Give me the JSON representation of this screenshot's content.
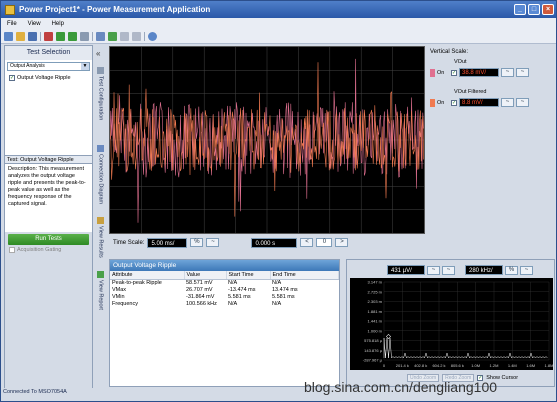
{
  "window": {
    "title": "Power Project1* - Power Measurement Application"
  },
  "menu": [
    "File",
    "View",
    "Help"
  ],
  "left": {
    "header": "Test Selection",
    "dropdown_value": "Output Analysis",
    "tree_item": "Output Voltage Ripple",
    "desc_title": "Test: Output Voltage Ripple",
    "desc_text": "Description: This measurement analyzes the output voltage ripple and presents the peak-to-peak value as well as the frequency response of the captured signal.",
    "run_button": "Run Tests",
    "gating_label": "Acquisition Gating"
  },
  "vtabs": [
    "Test Configuration",
    "Connection Diagram",
    "View Results",
    "View Report"
  ],
  "vertical_scale": {
    "label": "Vertical Scale:",
    "channels": [
      {
        "name": "VOut",
        "on": "On",
        "value": "38.8 mV/",
        "color": "#e07090"
      },
      {
        "name": "VOut Filtered",
        "on": "On",
        "value": "8.8 mV/",
        "color": "#f07a50"
      }
    ]
  },
  "timebar": {
    "label": "Time Scale:",
    "value": "5.00 ms/",
    "offset": "0.000 s",
    "page": "0"
  },
  "results": {
    "header": "Output Voltage Ripple",
    "columns": [
      "Attribute",
      "Value",
      "Start Time",
      "End Time"
    ],
    "rows": [
      [
        "Peak-to-peak Ripple",
        "58.571 mV",
        "N/A",
        "N/A"
      ],
      [
        "VMax",
        "26.707 mV",
        "-13.474 ms",
        "13.474 ms"
      ],
      [
        "VMin",
        "-31.864 mV",
        "5.581 ms",
        "5.581 ms"
      ],
      [
        "Frequency",
        "100.566 kHz",
        "N/A",
        "N/A"
      ]
    ]
  },
  "fft": {
    "yscale": "431 µV/",
    "xscale": "280 kHz/",
    "yticks": [
      "3.147 m",
      "2.725 m",
      "2.303 m",
      "1.881 m",
      "1.441 m",
      "1.000 m",
      "575.818 µ",
      "143.876 µ",
      "-287.967 µ"
    ],
    "xticks": [
      "0",
      "201.4 k",
      "402.8 k",
      "604.2 k",
      "805.6 k",
      "1.0M",
      "1.2M",
      "1.4M",
      "1.6M",
      "1.8M"
    ],
    "undo_zoom": "Undo Zoom",
    "redo_zoom": "Redo Zoom",
    "show_cursor": "Show Cursor"
  },
  "status": "Connected To MSO7054A",
  "watermark": "blog.sina.com.cn/dengliang100"
}
